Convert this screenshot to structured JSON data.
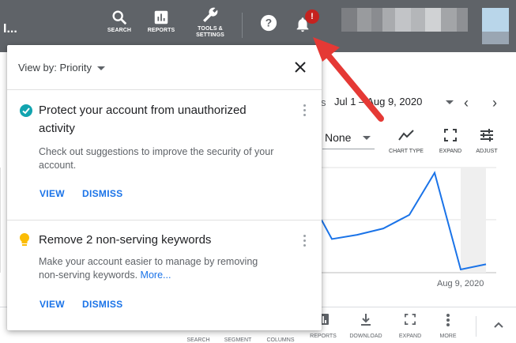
{
  "topbar": {
    "brand": "I...",
    "buttons": [
      {
        "label": "SEARCH",
        "icon": "search-icon"
      },
      {
        "label": "REPORTS",
        "icon": "reports-icon"
      },
      {
        "label": "TOOLS &",
        "label2": "SETTINGS",
        "icon": "wrench-icon"
      }
    ],
    "notification_badge": "!",
    "colors": {
      "bar": "#5f6368",
      "badge": "#c5221f"
    }
  },
  "background": {
    "date_prefix": "s",
    "date_range": "Jul 1 – Aug 9, 2020",
    "compare_value": "None",
    "chart_tools": [
      {
        "label": "CHART TYPE",
        "icon": "line-chart-icon"
      },
      {
        "label": "EXPAND",
        "icon": "expand-icon"
      },
      {
        "label": "ADJUST",
        "icon": "adjust-icon"
      }
    ],
    "x_axis_label": "Aug 9, 2020",
    "bottom_buttons": [
      "SEARCH",
      "SEGMENT",
      "COLUMNS",
      "REPORTS",
      "DOWNLOAD",
      "EXPAND",
      "MORE"
    ]
  },
  "chart_data": {
    "type": "line",
    "x": [
      "",
      "",
      "",
      "",
      "",
      "",
      "",
      "",
      ""
    ],
    "series": [
      {
        "values": [
          0.5,
          0.32,
          0.36,
          0.42,
          0.55,
          0.95,
          0.03,
          0.08
        ]
      }
    ],
    "xlabel": "",
    "ylabel": "",
    "tick_labels": [
      "Aug 9, 2020"
    ]
  },
  "popover": {
    "view_by": "View by: Priority",
    "cards": [
      {
        "title_line1": "Protect your account from unauthorized",
        "title_line2": "activity",
        "body_line1": "Check out suggestions to improve the security of your",
        "body_line2": "account.",
        "icon": "check-circle-icon",
        "actions": [
          "VIEW",
          "DISMISS"
        ]
      },
      {
        "title_line1": "Remove 2 non-serving keywords",
        "body_line1": "Make your account easier to manage by removing",
        "body_line2": "non-serving keywords.",
        "more_link": "More...",
        "icon": "lightbulb-icon",
        "actions": [
          "VIEW",
          "DISMISS"
        ]
      }
    ]
  },
  "annotation": {
    "arrow_color": "#e53935"
  }
}
